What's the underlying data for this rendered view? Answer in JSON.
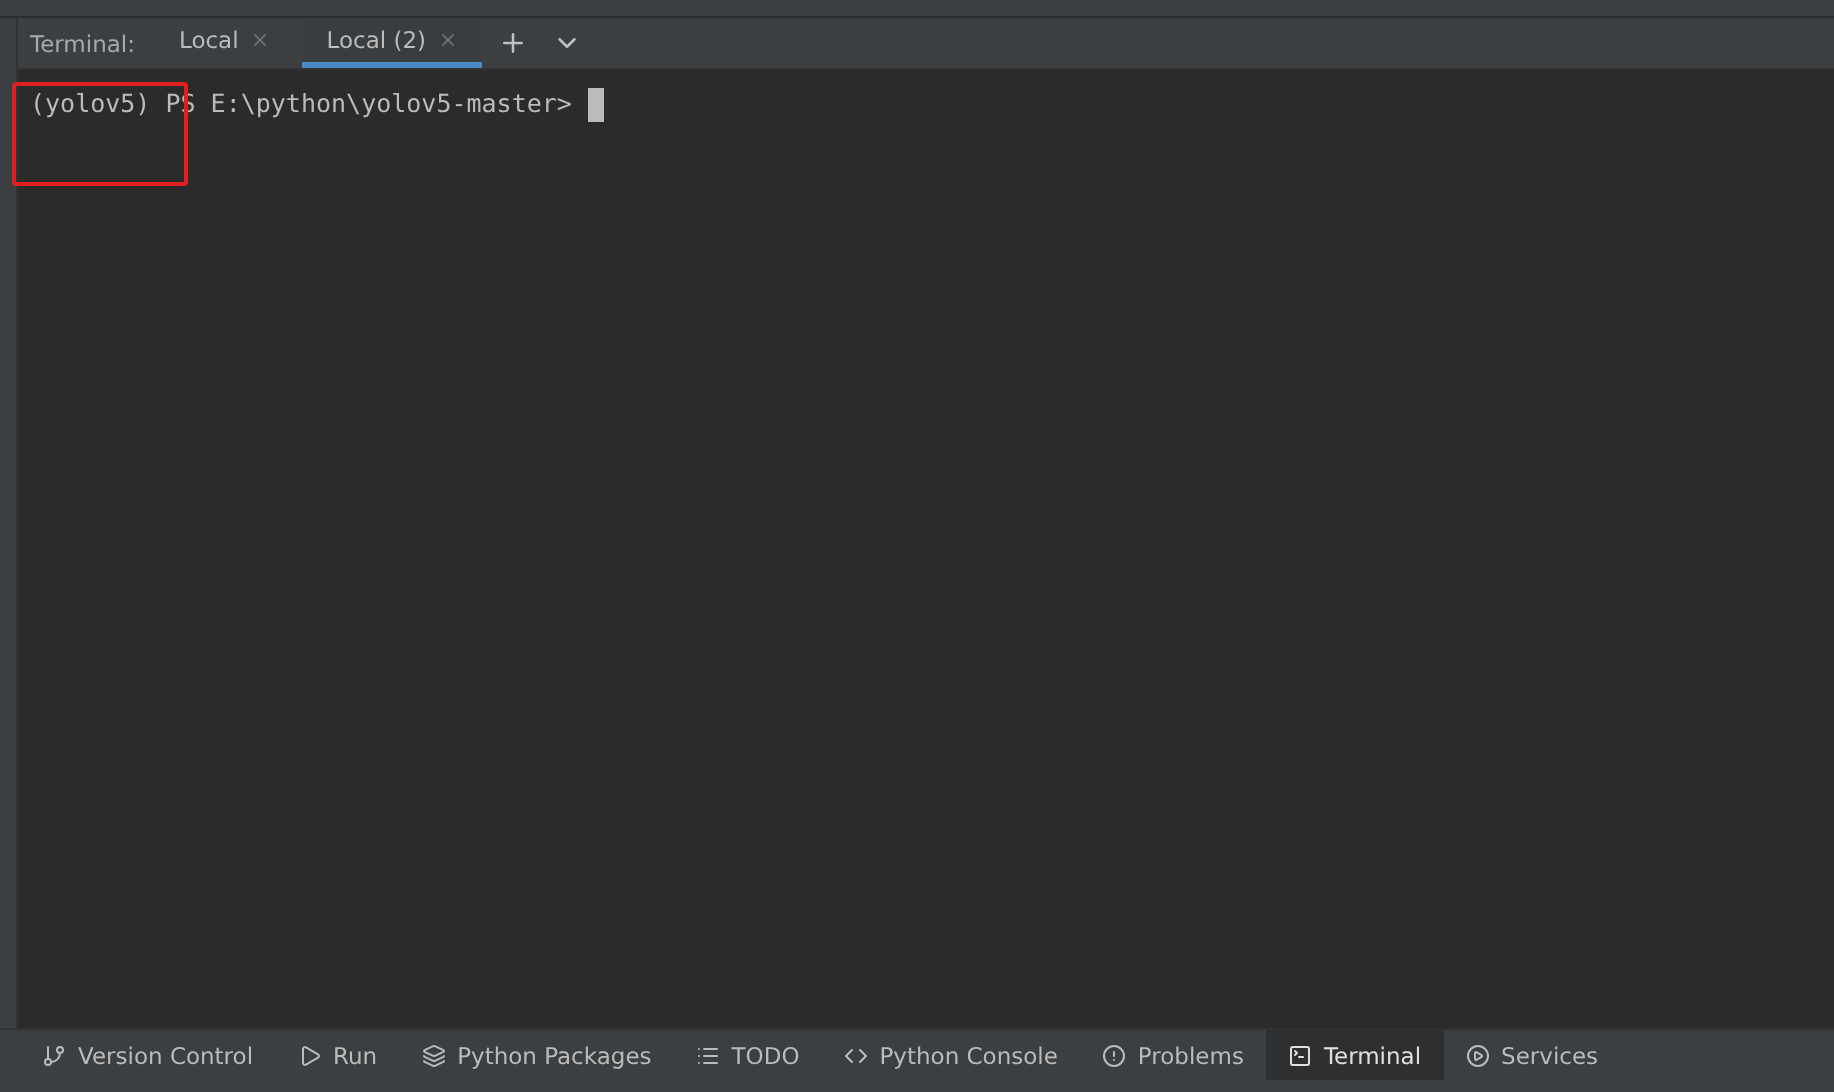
{
  "terminal": {
    "label": "Terminal:",
    "tabs": [
      {
        "title": "Local",
        "selected": false
      },
      {
        "title": "Local (2)",
        "selected": true
      }
    ],
    "prompt": "(yolov5) PS E:\\python\\yolov5-master>",
    "highlight": true
  },
  "toolwindows": [
    {
      "label": "Version Control",
      "kind": "branch",
      "selected": false
    },
    {
      "label": "Run",
      "kind": "play",
      "selected": false
    },
    {
      "label": "Python Packages",
      "kind": "layers",
      "selected": false
    },
    {
      "label": "TODO",
      "kind": "list",
      "selected": false
    },
    {
      "label": "Python Console",
      "kind": "python",
      "selected": false
    },
    {
      "label": "Problems",
      "kind": "alert",
      "selected": false
    },
    {
      "label": "Terminal",
      "kind": "terminal",
      "selected": true
    },
    {
      "label": "Services",
      "kind": "services",
      "selected": false
    }
  ]
}
